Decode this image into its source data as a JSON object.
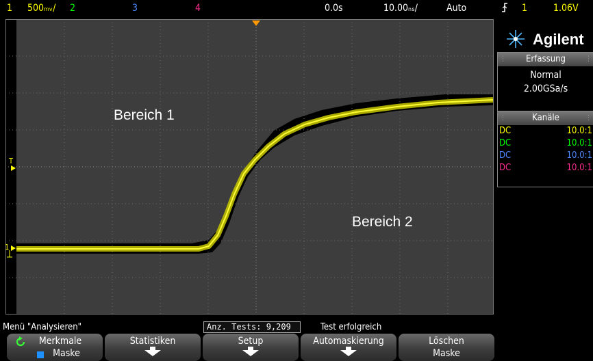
{
  "topbar": {
    "ch1_num": "1",
    "ch1_scale": "500ₘᵥ/",
    "ch2": "2",
    "ch3": "3",
    "ch4": "4",
    "time_delay": "0.0s",
    "time_scale": "10.00ₙₛ/",
    "trigger_mode": "Auto",
    "trigger_icon": "rising-edge-trigger",
    "trigger_source": "1",
    "trigger_level": "1.06V"
  },
  "screen": {
    "region1_label": "Bereich 1",
    "region2_label": "Bereich 2",
    "trigger_marker": "T",
    "ch1_marker": "1"
  },
  "brand": {
    "name": "Agilent"
  },
  "acquisition": {
    "title": "Erfassung",
    "mode": "Normal",
    "rate": "2.00GSa/s"
  },
  "channels": {
    "title": "Kanäle",
    "rows": [
      {
        "coupling": "DC",
        "value": "10.0:1",
        "color": "#ffff00"
      },
      {
        "coupling": "DC",
        "value": "10.0:1",
        "color": "#00ff00"
      },
      {
        "coupling": "DC",
        "value": "10.0:1",
        "color": "#4d88ff"
      },
      {
        "coupling": "DC",
        "value": "10.0:1",
        "color": "#ff2d8c"
      }
    ]
  },
  "statusline": {
    "menu": "Menü \"Analysieren\"",
    "tests": "Anz. Tests: 9,209",
    "result": "Test erfolgreich"
  },
  "softkeys": {
    "merkmale": {
      "l1": "Merkmale",
      "l2": "Maske"
    },
    "statistiken": {
      "l1": "Statistiken"
    },
    "setup": {
      "l1": "Setup"
    },
    "automaskierung": {
      "l1": "Automaskierung"
    },
    "loeschen": {
      "l1": "Löschen",
      "l2": "Maske"
    }
  },
  "colors": {
    "ch1": "#ffff00",
    "ch2": "#00ff00",
    "ch3": "#4d88ff",
    "ch4": "#ff2d8c",
    "trigger": "#ff9900",
    "grid_bg": "#3d3d3d"
  }
}
